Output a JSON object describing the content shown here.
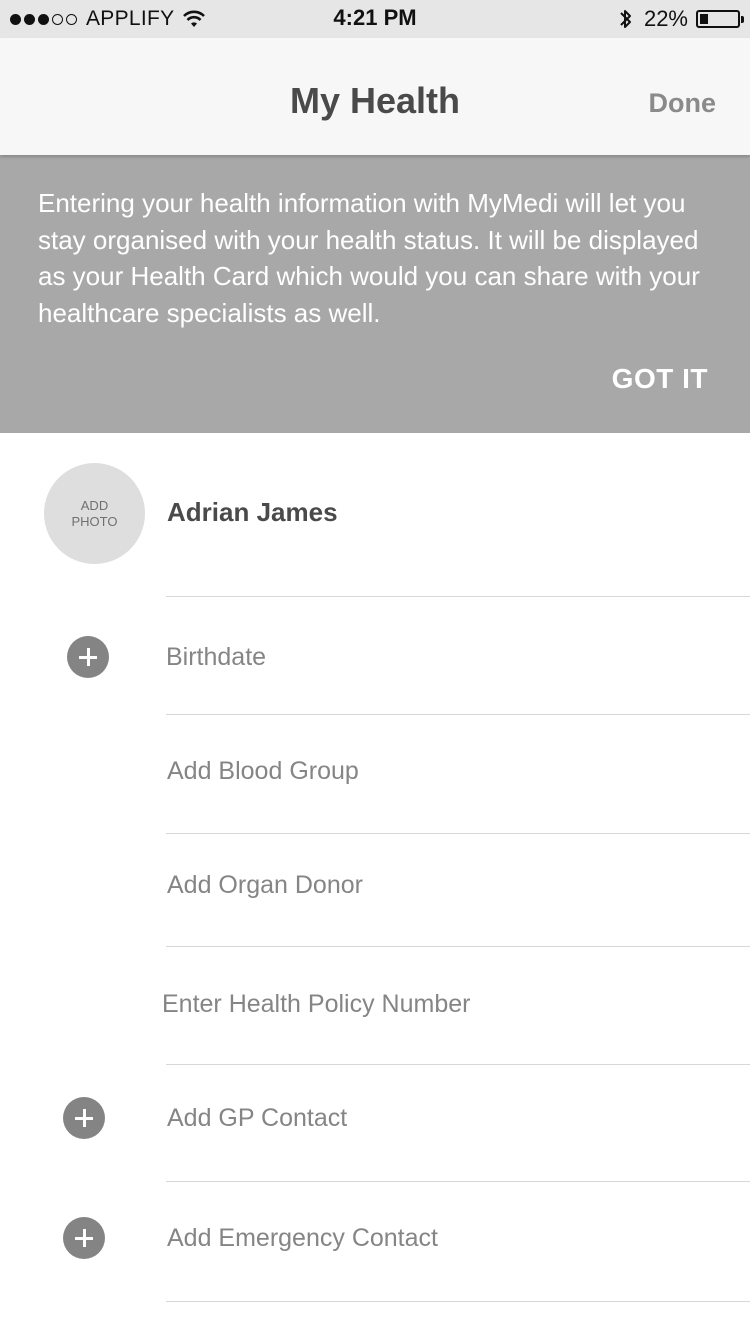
{
  "status_bar": {
    "signal": "●●●○○",
    "carrier": "APPLIFY",
    "time": "4:21 PM",
    "battery_percent": "22%",
    "battery_level": 0.22
  },
  "nav": {
    "title": "My Health",
    "done_label": "Done"
  },
  "banner": {
    "text": "Entering your health information with MyMedi will let you stay organised with your health status. It will be displayed as your Health Card which would you can share with your healthcare specialists as well.",
    "button_label": "GOT IT"
  },
  "profile": {
    "add_photo_line1": "ADD",
    "add_photo_line2": "PHOTO",
    "name": "Adrian James"
  },
  "fields": {
    "birthdate": "Birthdate",
    "blood_group": "Add Blood Group",
    "organ_donor": "Add Organ Donor",
    "health_policy": "Enter Health Policy Number",
    "gp_contact": "Add GP Contact",
    "emergency_contact": "Add Emergency Contact"
  },
  "colors": {
    "banner_bg": "#a8a8a8",
    "icon_bg": "#848484",
    "status_bar_bg": "#e6e6e6"
  }
}
